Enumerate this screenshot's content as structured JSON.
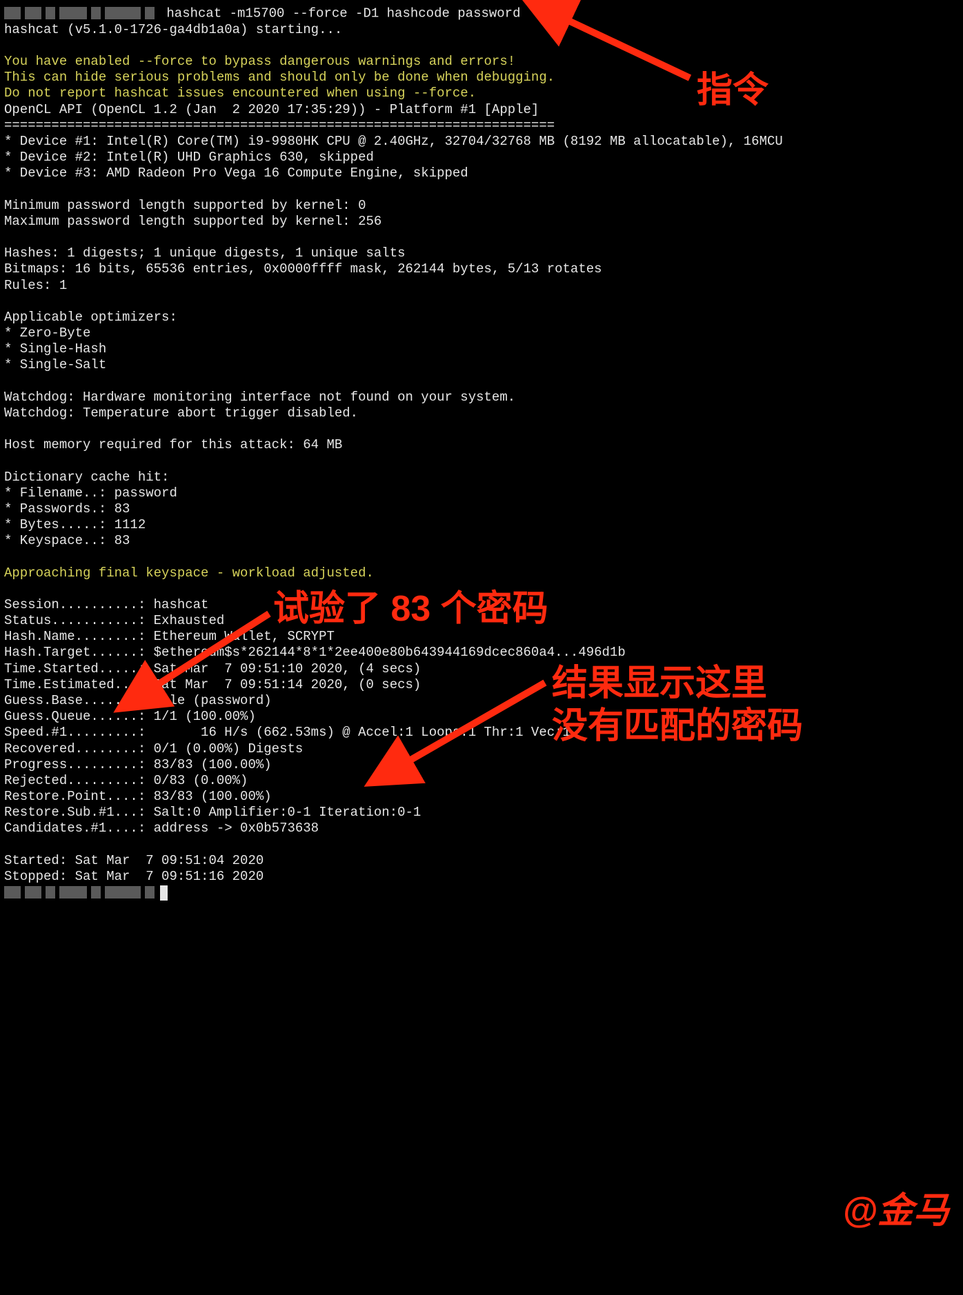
{
  "cmd": {
    "command": " hashcat -m15700 --force -D1 hashcode password",
    "starting": "hashcat (v5.1.0-1726-ga4db1a0a) starting..."
  },
  "warn": {
    "l1": "You have enabled --force to bypass dangerous warnings and errors!",
    "l2": "This can hide serious problems and should only be done when debugging.",
    "l3": "Do not report hashcat issues encountered when using --force."
  },
  "opencl": "OpenCL API (OpenCL 1.2 (Jan  2 2020 17:35:29)) - Platform #1 [Apple]",
  "hr": "======================================================================",
  "dev1": "* Device #1: Intel(R) Core(TM) i9-9980HK CPU @ 2.40GHz, 32704/32768 MB (8192 MB allocatable), 16MCU",
  "dev2": "* Device #2: Intel(R) UHD Graphics 630, skipped",
  "dev3": "* Device #3: AMD Radeon Pro Vega 16 Compute Engine, skipped",
  "minpw": "Minimum password length supported by kernel: 0",
  "maxpw": "Maximum password length supported by kernel: 256",
  "hashes": "Hashes: 1 digests; 1 unique digests, 1 unique salts",
  "bitmaps": "Bitmaps: 16 bits, 65536 entries, 0x0000ffff mask, 262144 bytes, 5/13 rotates",
  "rules": "Rules: 1",
  "applopt": "Applicable optimizers:",
  "opt1": "* Zero-Byte",
  "opt2": "* Single-Hash",
  "opt3": "* Single-Salt",
  "wd1": "Watchdog: Hardware monitoring interface not found on your system.",
  "wd2": "Watchdog: Temperature abort trigger disabled.",
  "hostmem": "Host memory required for this attack: 64 MB",
  "dicthit": "Dictionary cache hit:",
  "dfile": "* Filename..: password",
  "dpass": "* Passwords.: 83",
  "dbytes": "* Bytes.....: 1112",
  "dkeysp": "* Keyspace..: 83",
  "approach": "Approaching final keyspace - workload adjusted.",
  "s_session": "Session..........: hashcat",
  "s_status": "Status...........: Exhausted",
  "s_hashname": "Hash.Name........: Ethereum Wallet, SCRYPT",
  "s_hashtgt": "Hash.Target......: $ethereum$s*262144*8*1*2ee400e80b643944169dcec860a4...496d1b",
  "s_timestart": "Time.Started.....: Sat Mar  7 09:51:10 2020, (4 secs)",
  "s_timeest": "Time.Estimated...: Sat Mar  7 09:51:14 2020, (0 secs)",
  "s_guessbase": "Guess.Base.......: File (password)",
  "s_guessq": "Guess.Queue......: 1/1 (100.00%)",
  "s_speed": "Speed.#1.........:       16 H/s (662.53ms) @ Accel:1 Loops:1 Thr:1 Vec:1",
  "s_recovered": "Recovered........: 0/1 (0.00%) Digests",
  "s_progress": "Progress.........: 83/83 (100.00%)",
  "s_rejected": "Rejected.........: 0/83 (0.00%)",
  "s_restorept": "Restore.Point....: 83/83 (100.00%)",
  "s_restoresub": "Restore.Sub.#1...: Salt:0 Amplifier:0-1 Iteration:0-1",
  "s_candidates": "Candidates.#1....: address -> 0x0b573638",
  "started": "Started: Sat Mar  7 09:51:04 2020",
  "stopped": "Stopped: Sat Mar  7 09:51:16 2020",
  "annotations": {
    "command": "指令",
    "tried": "试验了 83 个密码",
    "result_l1": "结果显示这里",
    "result_l2": "没有匹配的密码",
    "signature": "@金马"
  }
}
